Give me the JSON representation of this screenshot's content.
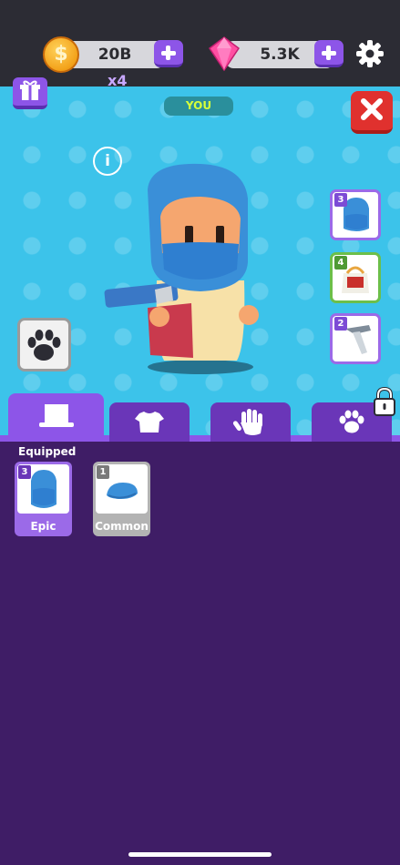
{
  "currencies": {
    "coins": {
      "value": "20B",
      "icon": "coin-icon",
      "symbol": "$"
    },
    "gems": {
      "value": "5.3K",
      "icon": "gem-icon"
    },
    "multiplier": "x4"
  },
  "player_badge": "YOU",
  "side_items": [
    {
      "level": "3",
      "icon": "blue-hood-icon"
    },
    {
      "level": "4",
      "icon": "paper-bag-icon"
    },
    {
      "level": "2",
      "icon": "pistol-icon"
    }
  ],
  "tabs": [
    {
      "icon": "hat-icon",
      "active": true
    },
    {
      "icon": "shirt-icon",
      "active": false
    },
    {
      "icon": "hand-icon",
      "active": false
    },
    {
      "icon": "paw-icon",
      "active": false,
      "locked": true
    }
  ],
  "inventory": {
    "section_label": "Equipped",
    "items": [
      {
        "level": "3",
        "rarity": "Epic",
        "icon": "blue-hood-icon"
      },
      {
        "level": "1",
        "rarity": "Common",
        "icon": "blue-cap-icon"
      }
    ]
  },
  "colors": {
    "accent": "#8d55e8",
    "panel": "#3f1d66",
    "stage": "#3cc3ea",
    "close": "#e0312e",
    "you_text": "#d6ff3a"
  }
}
